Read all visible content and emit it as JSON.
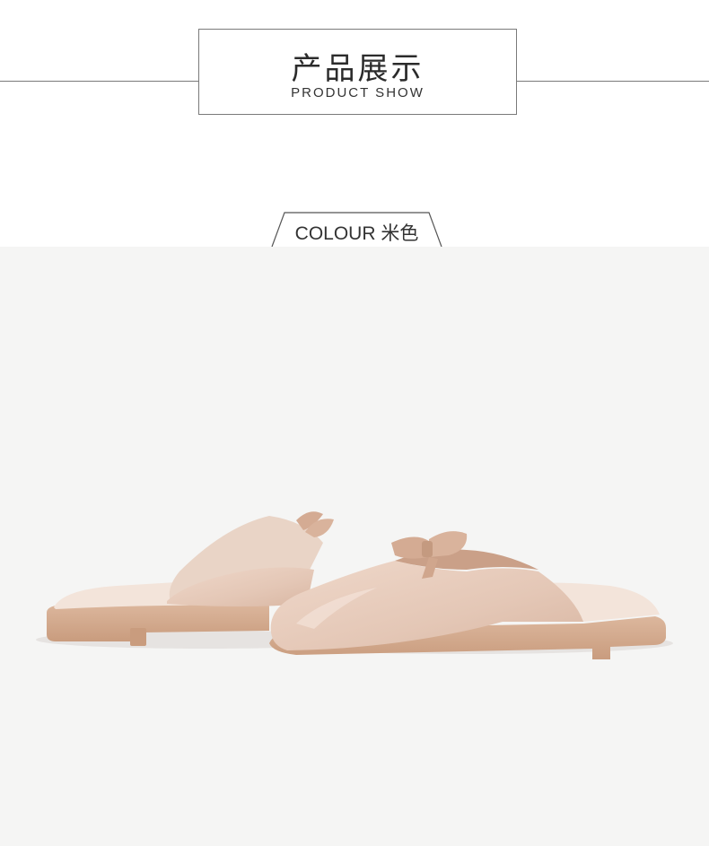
{
  "section_title": {
    "cn": "产品展示",
    "en": "PRODUCT SHOW"
  },
  "colour_tag": {
    "label": "COLOUR 米色"
  },
  "product_photo": {
    "subject": "slipper-pair-image",
    "colors": {
      "background": "#f5f5f4",
      "leather": "#e8cfc0",
      "sole": "#d1a98d",
      "lining": "#f0ddd2"
    }
  }
}
